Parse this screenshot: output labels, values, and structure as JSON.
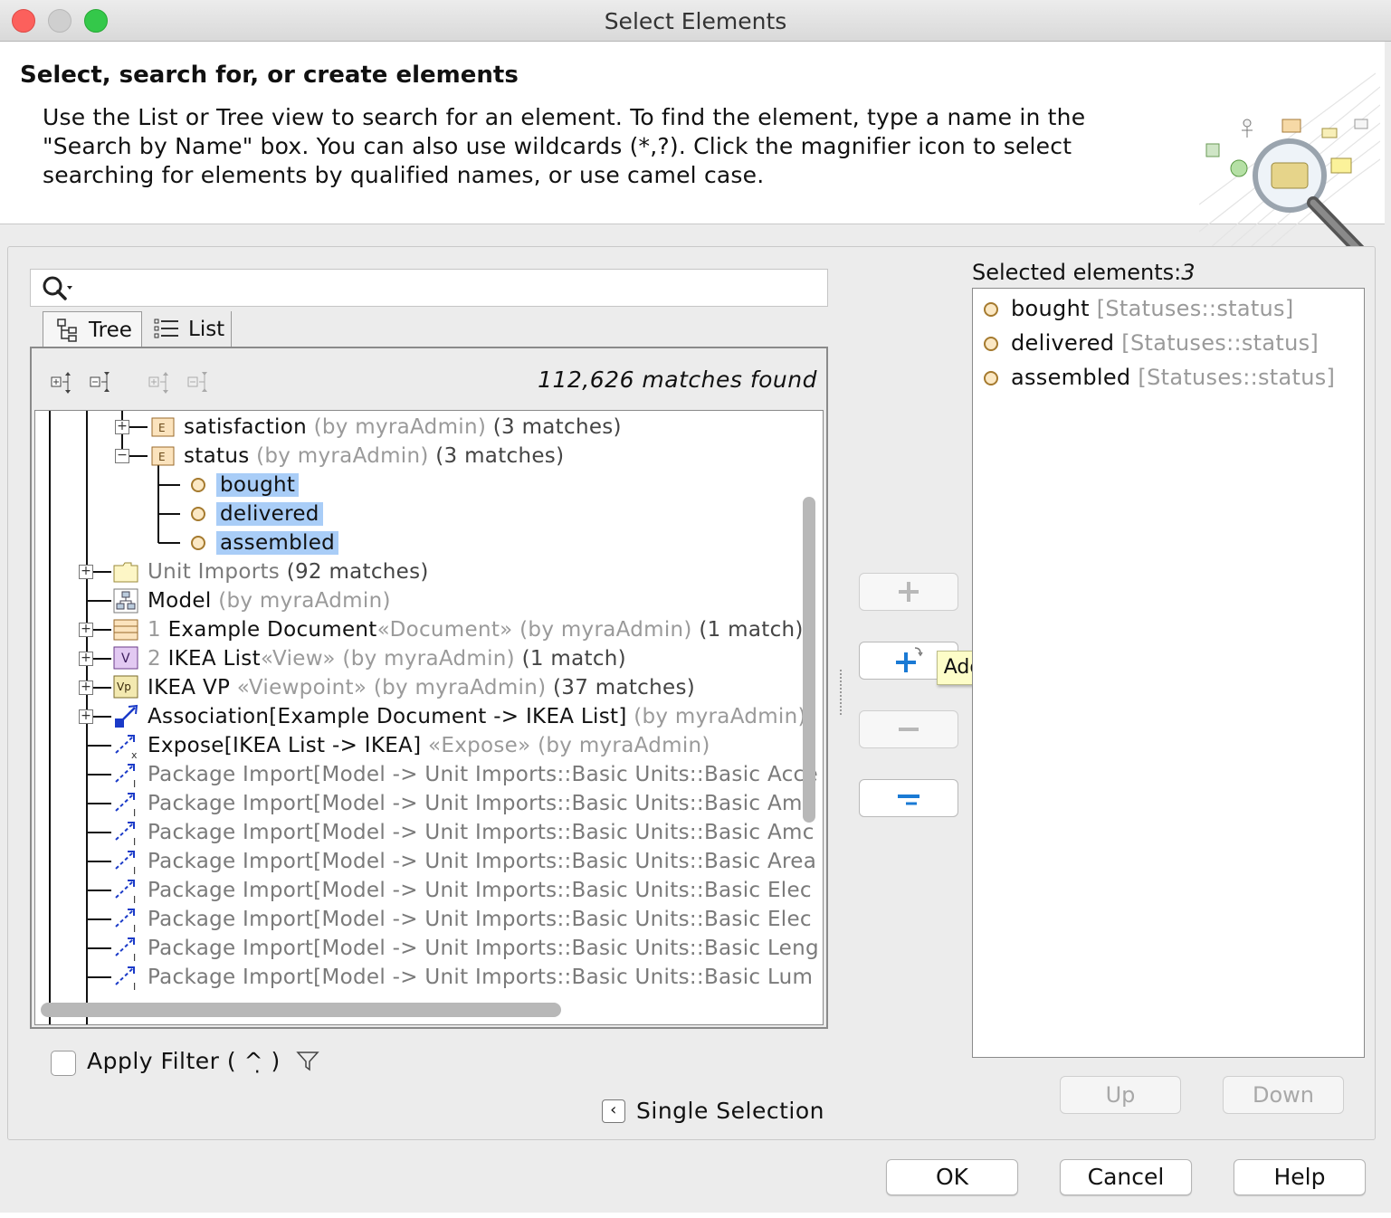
{
  "window": {
    "title": "Select Elements"
  },
  "header": {
    "title": "Select, search for, or create elements",
    "description": "Use the List or Tree view to search for an element. To find the element, type a name in the \"Search by Name\" box. You can also use wildcards (*,?). Click the magnifier icon to select searching for elements by qualified names, or use camel case."
  },
  "search": {
    "value": "",
    "icon": "magnifier-dropdown-icon"
  },
  "tabs": [
    {
      "label": "Tree",
      "icon": "tree-view-icon",
      "active": true
    },
    {
      "label": "List",
      "icon": "list-view-icon",
      "active": false
    }
  ],
  "tree": {
    "matches_text": "112,626 matches found",
    "rows": [
      {
        "name": "satisfaction",
        "owner": "(by myraAdmin)",
        "matches": "(3 matches)"
      },
      {
        "name": "status",
        "owner": "(by myraAdmin)",
        "matches": "(3 matches)"
      },
      {
        "name": "bought"
      },
      {
        "name": "delivered"
      },
      {
        "name": "assembled"
      },
      {
        "name": "Unit Imports",
        "matches": "(92 matches)"
      },
      {
        "name": "Model",
        "owner": "(by myraAdmin)"
      },
      {
        "prefix": "1",
        "name": "Example Document",
        "stereo": "«Document»",
        "owner": "(by myraAdmin)",
        "matches": "(1 match)"
      },
      {
        "prefix": "2",
        "name": "IKEA List",
        "stereo": "«View»",
        "owner": "(by myraAdmin)",
        "matches": "(1 match)"
      },
      {
        "name": "IKEA VP",
        "stereo": "«Viewpoint»",
        "owner": "(by myraAdmin)",
        "matches": "(37 matches)"
      },
      {
        "name": "Association[Example Document -> IKEA List]",
        "owner": "(by myraAdmin)"
      },
      {
        "name": "Expose[IKEA List -> IKEA]",
        "stereo": "«Expose»",
        "owner": "(by myraAdmin)"
      },
      {
        "name": "Package Import[Model -> Unit Imports::Basic Units::Basic Acce"
      },
      {
        "name": "Package Import[Model -> Unit Imports::Basic Units::Basic Amc"
      },
      {
        "name": "Package Import[Model -> Unit Imports::Basic Units::Basic Amc"
      },
      {
        "name": "Package Import[Model -> Unit Imports::Basic Units::Basic Area"
      },
      {
        "name": "Package Import[Model -> Unit Imports::Basic Units::Basic Elec"
      },
      {
        "name": "Package Import[Model -> Unit Imports::Basic Units::Basic Elec"
      },
      {
        "name": "Package Import[Model -> Unit Imports::Basic Units::Basic Leng"
      },
      {
        "name": "Package Import[Model -> Unit Imports::Basic Units::Basic Lum"
      }
    ]
  },
  "middle": {
    "tooltip": "Add"
  },
  "selected": {
    "label": "Selected elements:",
    "count": "3",
    "items": [
      {
        "name": "bought",
        "path": "[Statuses::status]"
      },
      {
        "name": "delivered",
        "path": "[Statuses::status]"
      },
      {
        "name": "assembled",
        "path": "[Statuses::status]"
      }
    ],
    "up_label": "Up",
    "down_label": "Down"
  },
  "filter": {
    "label": "Apply Filter ( ^̣ )",
    "checked": false
  },
  "single_selection": {
    "label": "Single Selection"
  },
  "buttons": {
    "ok": "OK",
    "cancel": "Cancel",
    "help": "Help"
  },
  "colors": {
    "selection": "#a9cdf7",
    "accent_blue": "#1a7ad4",
    "tooltip_bg": "#fdfdc8"
  }
}
